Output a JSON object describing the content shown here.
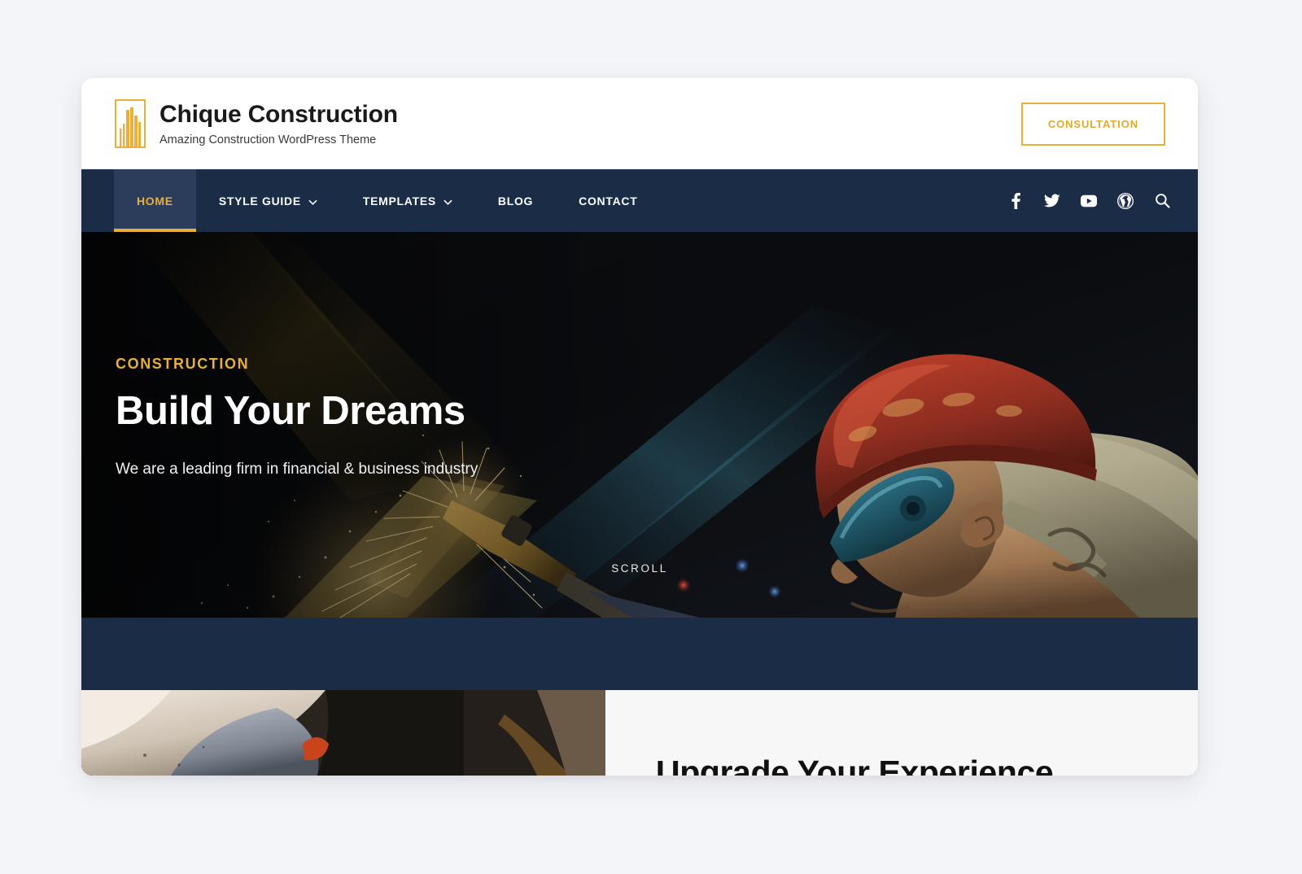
{
  "theme": {
    "page_bg": "#f4f5f8",
    "navy": "#1b2c47",
    "navy_active": "#2b3d5b",
    "gold": "#e8b03a",
    "white": "#ffffff"
  },
  "header": {
    "logo_icon": "building-logo-icon",
    "site_title": "Chique Construction",
    "tagline": "Amazing Construction WordPress Theme",
    "consultation_label": "CONSULTATION"
  },
  "nav": {
    "items": [
      {
        "label": "HOME",
        "active": true,
        "has_dropdown": false
      },
      {
        "label": "STYLE GUIDE",
        "active": false,
        "has_dropdown": true
      },
      {
        "label": "TEMPLATES",
        "active": false,
        "has_dropdown": true
      },
      {
        "label": "BLOG",
        "active": false,
        "has_dropdown": false
      },
      {
        "label": "CONTACT",
        "active": false,
        "has_dropdown": false
      }
    ],
    "social": [
      {
        "name": "facebook-icon"
      },
      {
        "name": "twitter-icon"
      },
      {
        "name": "youtube-icon"
      },
      {
        "name": "wordpress-icon"
      },
      {
        "name": "search-icon"
      }
    ]
  },
  "hero": {
    "eyebrow": "CONSTRUCTION",
    "title": "Build Your Dreams",
    "subtitle": "We are a leading firm in financial & business industry",
    "scroll_label": "SCROLL",
    "image_alt": "welder-with-red-hard-hat"
  },
  "feature": {
    "image_alt": "construction-worker-kneeling",
    "heading": "Upgrade Your Experience"
  }
}
